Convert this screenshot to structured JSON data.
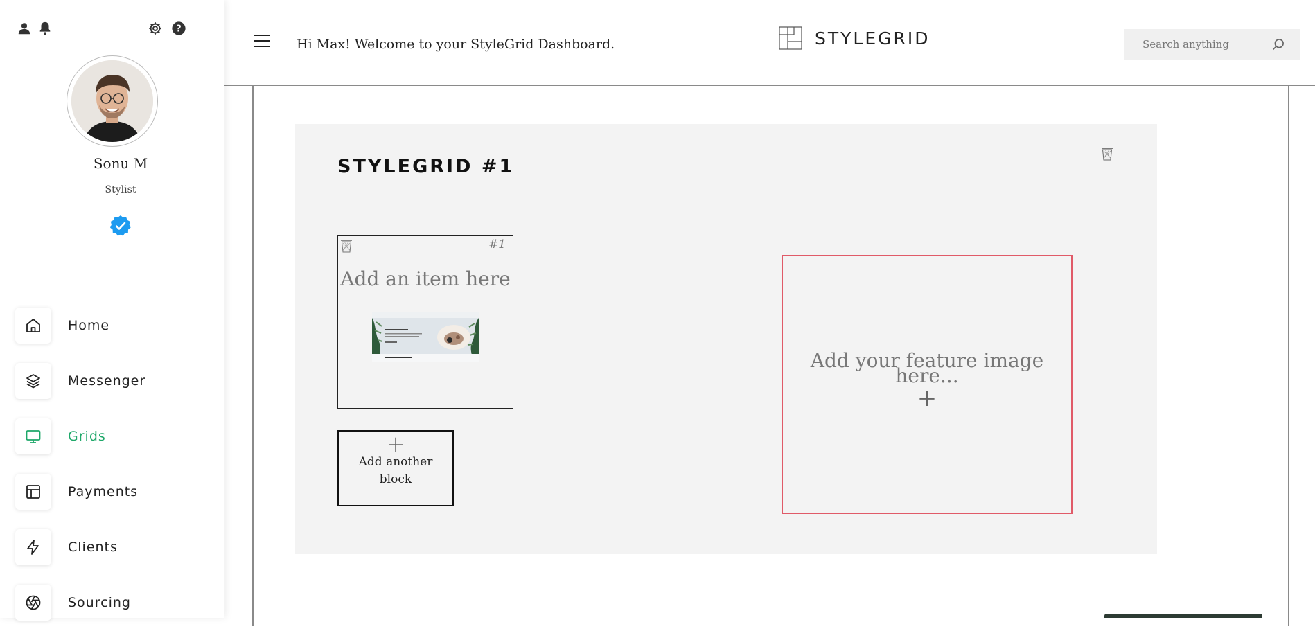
{
  "sidebar": {
    "user": {
      "name": "Sonu M",
      "role": "Stylist",
      "verified": true
    },
    "top_icons": [
      "user-icon",
      "bell-icon",
      "gear-icon",
      "help-icon"
    ],
    "nav": [
      {
        "label": "Home",
        "icon": "home-icon",
        "active": false
      },
      {
        "label": "Messenger",
        "icon": "layers-icon",
        "active": false
      },
      {
        "label": "Grids",
        "icon": "monitor-icon",
        "active": true
      },
      {
        "label": "Payments",
        "icon": "layout-icon",
        "active": false
      },
      {
        "label": "Clients",
        "icon": "lightning-icon",
        "active": false
      },
      {
        "label": "Sourcing",
        "icon": "aperture-icon",
        "active": false
      }
    ]
  },
  "header": {
    "welcome": "Hi Max! Welcome to your StyleGrid Dashboard.",
    "brand": "STYLEGRID",
    "search_placeholder": "Search anything"
  },
  "grid": {
    "title": "STYLEGRID #1",
    "block": {
      "number": "#1",
      "title": "Add an item here"
    },
    "add_block": {
      "plus": "+",
      "label": "Add another block"
    },
    "feature": {
      "label": "Add your feature image here...",
      "plus": "+"
    }
  },
  "colors": {
    "accent": "#1fa86a",
    "feature_border": "#e05a68",
    "panel_bg": "#f3f3f3",
    "verified": "#1d9bf0"
  }
}
